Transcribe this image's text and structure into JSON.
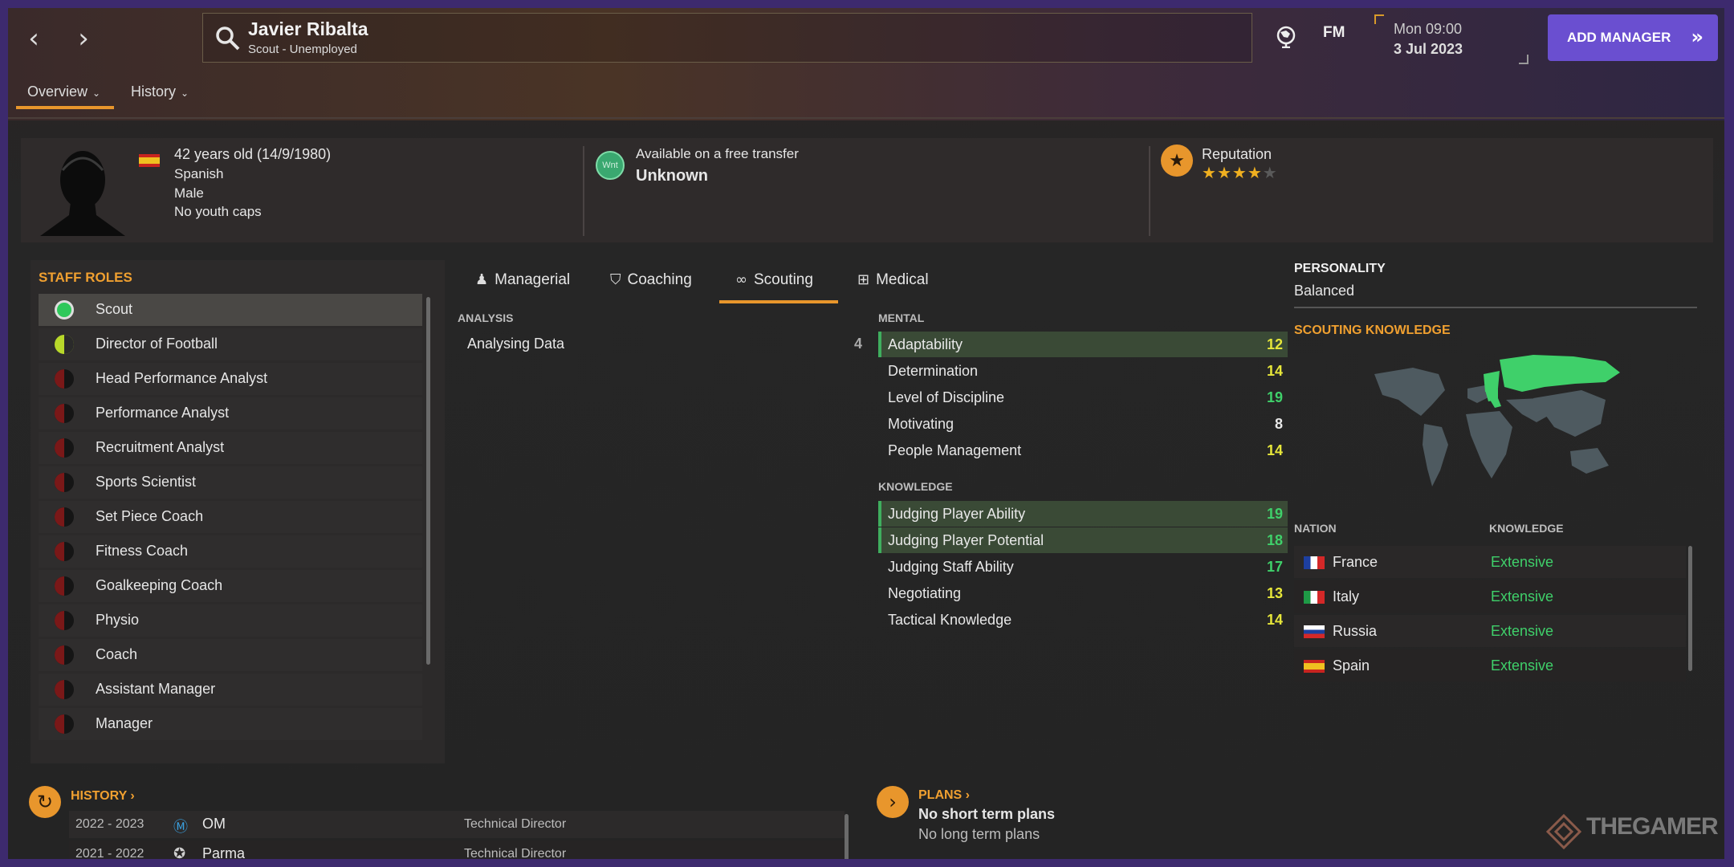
{
  "header": {
    "name": "Javier Ribalta",
    "subtitle": "Scout - Unemployed",
    "fm_label": "FM",
    "date_line1": "Mon 09:00",
    "date_line2": "3 Jul 2023",
    "add_manager": "ADD MANAGER"
  },
  "nav_tabs": [
    {
      "label": "Overview"
    },
    {
      "label": "History"
    }
  ],
  "profile": {
    "age": "42 years old (14/9/1980)",
    "nationality": "Spanish",
    "gender": "Male",
    "youth_caps": "No youth caps",
    "wnt_badge": "Wnt",
    "transfer_status": "Available on a free transfer",
    "transfer_value": "Unknown",
    "reputation_label": "Reputation",
    "reputation_stars": 4,
    "reputation_max": 5
  },
  "staff_roles": {
    "title": "STAFF ROLES",
    "items": [
      {
        "label": "Scout",
        "suitability": "full"
      },
      {
        "label": "Director of Football",
        "suitability": "half"
      },
      {
        "label": "Head Performance Analyst",
        "suitability": "low"
      },
      {
        "label": "Performance Analyst",
        "suitability": "low"
      },
      {
        "label": "Recruitment Analyst",
        "suitability": "low"
      },
      {
        "label": "Sports Scientist",
        "suitability": "low"
      },
      {
        "label": "Set Piece Coach",
        "suitability": "low"
      },
      {
        "label": "Fitness Coach",
        "suitability": "low"
      },
      {
        "label": "Goalkeeping Coach",
        "suitability": "low"
      },
      {
        "label": "Physio",
        "suitability": "low"
      },
      {
        "label": "Coach",
        "suitability": "low"
      },
      {
        "label": "Assistant Manager",
        "suitability": "low"
      },
      {
        "label": "Manager",
        "suitability": "low"
      }
    ]
  },
  "attr_tabs": [
    {
      "label": "Managerial",
      "icon": "managerial-icon"
    },
    {
      "label": "Coaching",
      "icon": "coaching-icon"
    },
    {
      "label": "Scouting",
      "icon": "binoculars-icon",
      "active": true
    },
    {
      "label": "Medical",
      "icon": "medical-kit-icon"
    }
  ],
  "analysis": {
    "header": "ANALYSIS",
    "items": [
      {
        "label": "Analysing Data",
        "value": "4"
      }
    ]
  },
  "mental": {
    "header": "MENTAL",
    "items": [
      {
        "label": "Adaptability",
        "value": "12",
        "highlight": true
      },
      {
        "label": "Determination",
        "value": "14"
      },
      {
        "label": "Level of Discipline",
        "value": "19"
      },
      {
        "label": "Motivating",
        "value": "8"
      },
      {
        "label": "People Management",
        "value": "14"
      }
    ]
  },
  "knowledge": {
    "header": "KNOWLEDGE",
    "items": [
      {
        "label": "Judging Player Ability",
        "value": "19",
        "highlight": true
      },
      {
        "label": "Judging Player Potential",
        "value": "18",
        "highlight": true
      },
      {
        "label": "Judging Staff Ability",
        "value": "17"
      },
      {
        "label": "Negotiating",
        "value": "13"
      },
      {
        "label": "Tactical Knowledge",
        "value": "14"
      }
    ]
  },
  "personality": {
    "header": "PERSONALITY",
    "value": "Balanced"
  },
  "scouting_knowledge": {
    "title": "SCOUTING KNOWLEDGE",
    "col_nation": "NATION",
    "col_knowledge": "KNOWLEDGE",
    "rows": [
      {
        "nation": "France",
        "knowledge": "Extensive"
      },
      {
        "nation": "Italy",
        "knowledge": "Extensive"
      },
      {
        "nation": "Russia",
        "knowledge": "Extensive"
      },
      {
        "nation": "Spain",
        "knowledge": "Extensive"
      }
    ]
  },
  "history": {
    "title": "HISTORY",
    "rows": [
      {
        "years": "2022 - 2023",
        "club": "OM",
        "role": "Technical Director"
      },
      {
        "years": "2021 - 2022",
        "club": "Parma",
        "role": "Technical Director"
      }
    ]
  },
  "plans": {
    "title": "PLANS",
    "short_term": "No short term plans",
    "long_term": "No long term plans"
  },
  "watermark": "THEGAMER",
  "colors": {
    "accent_orange": "#e8962c",
    "attr_green": "#3fd06a",
    "attr_yellow": "#e6e63a",
    "add_manager_purple": "#6a4fd0"
  }
}
